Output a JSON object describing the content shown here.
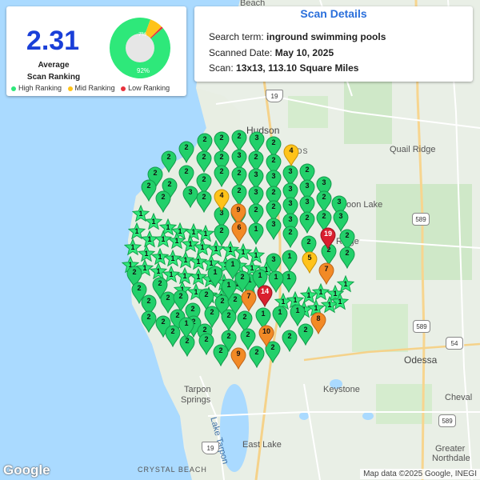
{
  "summary": {
    "average_value": "2.31",
    "average_label_line1": "Average",
    "average_label_line2": "Scan Ranking",
    "donut": {
      "high_pct": 92,
      "mid_pct": 7,
      "low_pct": 1,
      "high_label": "92%",
      "mid_label": "7%"
    },
    "legend": {
      "high": "High Ranking",
      "mid": "Mid Ranking",
      "low": "Low Ranking"
    },
    "colors": {
      "high": "#2ee87a",
      "mid": "#ffc31a",
      "low": "#e8323c",
      "value": "#1a3fd8"
    }
  },
  "details": {
    "title": "Scan Details",
    "search_label": "Search term:",
    "search_value": "inground swimming pools",
    "date_label": "Scanned Date:",
    "date_value": "May 10, 2025",
    "scan_label": "Scan:",
    "scan_value": "13x13, 113.10 Square Miles"
  },
  "map": {
    "labels": {
      "hudson": "Hudson",
      "quail_ridge": "Quail Ridge",
      "moon_lake": "oon Lake",
      "ridge_manor": "Ridge",
      "odessa": "Odessa",
      "keystone": "Keystone",
      "tarpon_springs_1": "Tarpon",
      "tarpon_springs_2": "Springs",
      "east_lake": "East Lake",
      "cheval": "Cheval",
      "greater_northdale_1": "Greater",
      "greater_northdale_2": "Northdale",
      "crystal_beach": "CRYSTAL BEACH",
      "lake_tarpon": "Lake Tarpon",
      "beach": "Beach",
      "woods": "OODS"
    },
    "shields": [
      "19",
      "589",
      "589",
      "54",
      "589",
      "19"
    ],
    "google_logo": "Google",
    "attribution": "Map data ©2025 Google, INEGI"
  },
  "pins": {
    "stars": [
      [
        176,
        268,
        1
      ],
      [
        192,
        278,
        1
      ],
      [
        210,
        285,
        1
      ],
      [
        225,
        290,
        1
      ],
      [
        242,
        291,
        1
      ],
      [
        257,
        293,
        1
      ],
      [
        171,
        290,
        1
      ],
      [
        187,
        300,
        1
      ],
      [
        204,
        300,
        1
      ],
      [
        221,
        302,
        1
      ],
      [
        238,
        306,
        1
      ],
      [
        253,
        310,
        1
      ],
      [
        270,
        312,
        1
      ],
      [
        288,
        313,
        1
      ],
      [
        304,
        316,
        1
      ],
      [
        320,
        320,
        1
      ],
      [
        166,
        310,
        1
      ],
      [
        183,
        318,
        1
      ],
      [
        200,
        322,
        1
      ],
      [
        216,
        324,
        1
      ],
      [
        232,
        326,
        1
      ],
      [
        248,
        328,
        1
      ],
      [
        264,
        330,
        1
      ],
      [
        282,
        332,
        1
      ],
      [
        298,
        333,
        1
      ],
      [
        315,
        336,
        1
      ],
      [
        333,
        338,
        1
      ],
      [
        163,
        332,
        1
      ],
      [
        181,
        336,
        1
      ],
      [
        198,
        340,
        1
      ],
      [
        214,
        344,
        1
      ],
      [
        231,
        346,
        1
      ],
      [
        248,
        347,
        1
      ],
      [
        263,
        350,
        1
      ],
      [
        280,
        354,
        1
      ],
      [
        296,
        356,
        1
      ],
      [
        312,
        358,
        1
      ],
      [
        228,
        363,
        1
      ],
      [
        245,
        366,
        1
      ],
      [
        261,
        370,
        1
      ],
      [
        277,
        372,
        1
      ],
      [
        354,
        378,
        1
      ],
      [
        369,
        376,
        1
      ],
      [
        386,
        370,
        1
      ],
      [
        401,
        366,
        1
      ],
      [
        419,
        368,
        1
      ],
      [
        432,
        356,
        1
      ],
      [
        380,
        388,
        1
      ],
      [
        395,
        386,
        1
      ],
      [
        412,
        382,
        1
      ],
      [
        425,
        378,
        1
      ]
    ],
    "greens": [
      [
        256,
        190,
        2
      ],
      [
        277,
        188,
        2
      ],
      [
        299,
        186,
        2
      ],
      [
        321,
        188,
        3
      ],
      [
        342,
        194,
        2
      ],
      [
        233,
        200,
        2
      ],
      [
        255,
        212,
        2
      ],
      [
        277,
        212,
        2
      ],
      [
        299,
        210,
        3
      ],
      [
        320,
        212,
        2
      ],
      [
        342,
        216,
        2
      ],
      [
        211,
        212,
        2
      ],
      [
        233,
        230,
        2
      ],
      [
        277,
        230,
        2
      ],
      [
        299,
        232,
        2
      ],
      [
        320,
        234,
        3
      ],
      [
        342,
        236,
        3
      ],
      [
        363,
        230,
        3
      ],
      [
        384,
        228,
        2
      ],
      [
        194,
        232,
        2
      ],
      [
        212,
        246,
        2
      ],
      [
        255,
        240,
        2
      ],
      [
        299,
        254,
        2
      ],
      [
        320,
        256,
        3
      ],
      [
        342,
        256,
        2
      ],
      [
        363,
        252,
        3
      ],
      [
        384,
        248,
        3
      ],
      [
        405,
        244,
        3
      ],
      [
        186,
        248,
        2
      ],
      [
        204,
        262,
        2
      ],
      [
        238,
        256,
        3
      ],
      [
        255,
        262,
        2
      ],
      [
        320,
        278,
        2
      ],
      [
        342,
        274,
        2
      ],
      [
        363,
        270,
        3
      ],
      [
        384,
        268,
        3
      ],
      [
        405,
        262,
        2
      ],
      [
        424,
        268,
        3
      ],
      [
        277,
        282,
        3
      ],
      [
        298,
        280,
        2
      ],
      [
        342,
        296,
        3
      ],
      [
        363,
        290,
        3
      ],
      [
        384,
        288,
        2
      ],
      [
        405,
        286,
        2
      ],
      [
        426,
        286,
        3
      ],
      [
        277,
        304,
        2
      ],
      [
        320,
        302,
        1
      ],
      [
        363,
        306,
        2
      ],
      [
        386,
        318,
        2
      ],
      [
        434,
        310,
        2
      ],
      [
        342,
        340,
        3
      ],
      [
        362,
        336,
        1
      ],
      [
        434,
        332,
        2
      ],
      [
        411,
        328,
        2
      ],
      [
        168,
        356,
        2
      ],
      [
        174,
        376,
        2
      ],
      [
        186,
        392,
        2
      ],
      [
        200,
        370,
        2
      ],
      [
        210,
        388,
        2
      ],
      [
        226,
        386,
        2
      ],
      [
        241,
        402,
        2
      ],
      [
        258,
        384,
        2
      ],
      [
        278,
        392,
        2
      ],
      [
        294,
        390,
        2
      ],
      [
        186,
        412,
        2
      ],
      [
        204,
        418,
        2
      ],
      [
        222,
        410,
        2
      ],
      [
        242,
        418,
        2
      ],
      [
        265,
        406,
        2
      ],
      [
        286,
        410,
        2
      ],
      [
        306,
        412,
        2
      ],
      [
        329,
        408,
        1
      ],
      [
        350,
        406,
        1
      ],
      [
        372,
        404,
        1
      ],
      [
        216,
        430,
        2
      ],
      [
        234,
        442,
        2
      ],
      [
        256,
        428,
        2
      ],
      [
        276,
        454,
        2
      ],
      [
        286,
        436,
        2
      ],
      [
        310,
        434,
        2
      ],
      [
        321,
        456,
        2
      ],
      [
        341,
        450,
        2
      ],
      [
        362,
        436,
        2
      ],
      [
        382,
        428,
        2
      ],
      [
        233,
        420,
        1
      ],
      [
        291,
        346,
        1
      ],
      [
        312,
        366,
        1
      ],
      [
        269,
        356,
        1
      ],
      [
        286,
        372,
        1
      ],
      [
        361,
        362,
        1
      ],
      [
        345,
        362,
        1
      ],
      [
        325,
        360,
        1
      ],
      [
        303,
        362,
        2
      ],
      [
        258,
        440,
        2
      ]
    ],
    "yellows": [
      [
        364,
        204,
        4
      ],
      [
        277,
        260,
        4
      ],
      [
        387,
        338,
        5
      ]
    ],
    "oranges": [
      [
        298,
        278,
        9
      ],
      [
        299,
        300,
        6
      ],
      [
        408,
        352,
        7
      ],
      [
        311,
        386,
        7
      ],
      [
        333,
        430,
        10
      ],
      [
        398,
        414,
        8
      ],
      [
        298,
        458,
        9
      ]
    ],
    "reds": [
      [
        410,
        308,
        19
      ],
      [
        331,
        380,
        14
      ]
    ]
  }
}
